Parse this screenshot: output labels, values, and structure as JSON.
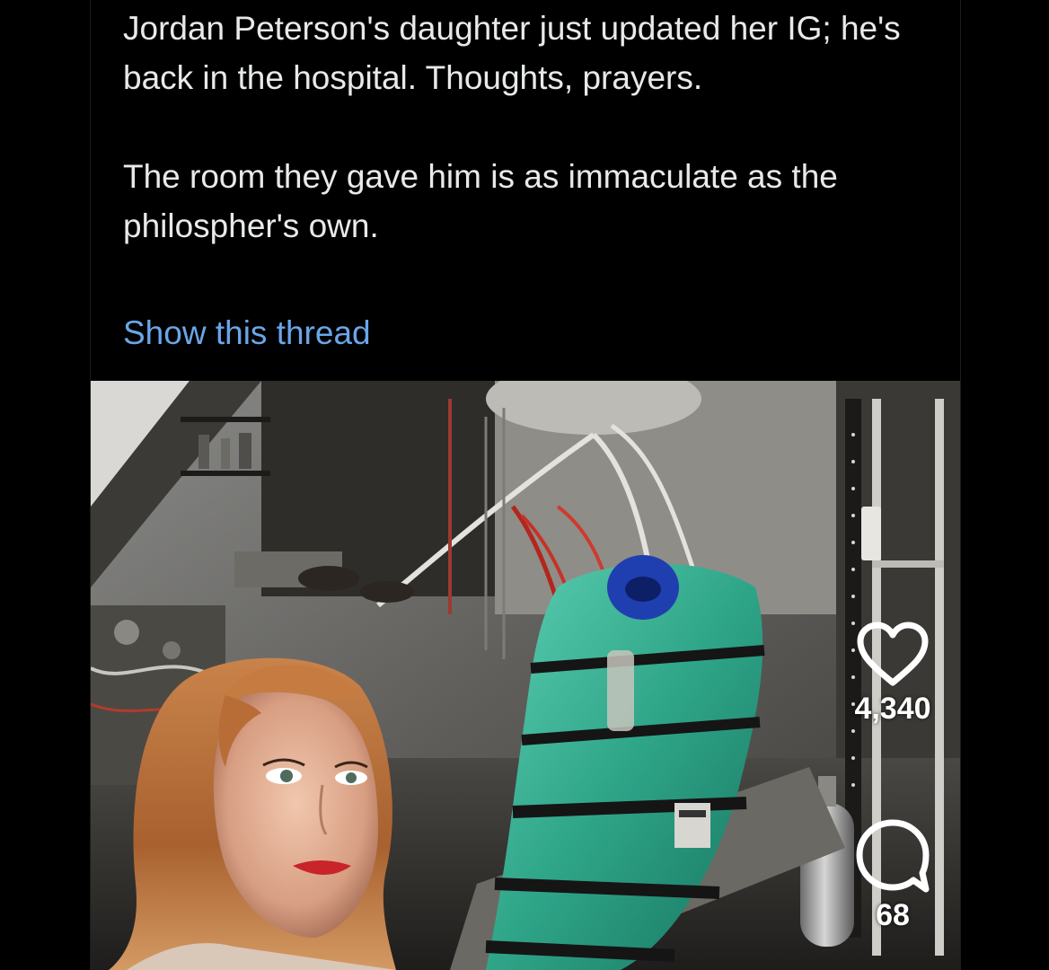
{
  "tweet": {
    "paragraph_1": "Jordan Peterson's daughter just updated her IG; he's back in the hospital. Thoughts, prayers.",
    "paragraph_2": "The room they gave him is as immaculate as the philospher's own.",
    "show_thread_label": "Show this thread"
  },
  "actions": {
    "like_icon": "heart-icon",
    "like_count": "4,340",
    "comment_icon": "comment-bubble-icon",
    "comment_count": "68"
  },
  "colors": {
    "background": "#000000",
    "text": "#e7e9ea",
    "link": "#6aa6e8",
    "overlay_icons": "#ffffff"
  }
}
